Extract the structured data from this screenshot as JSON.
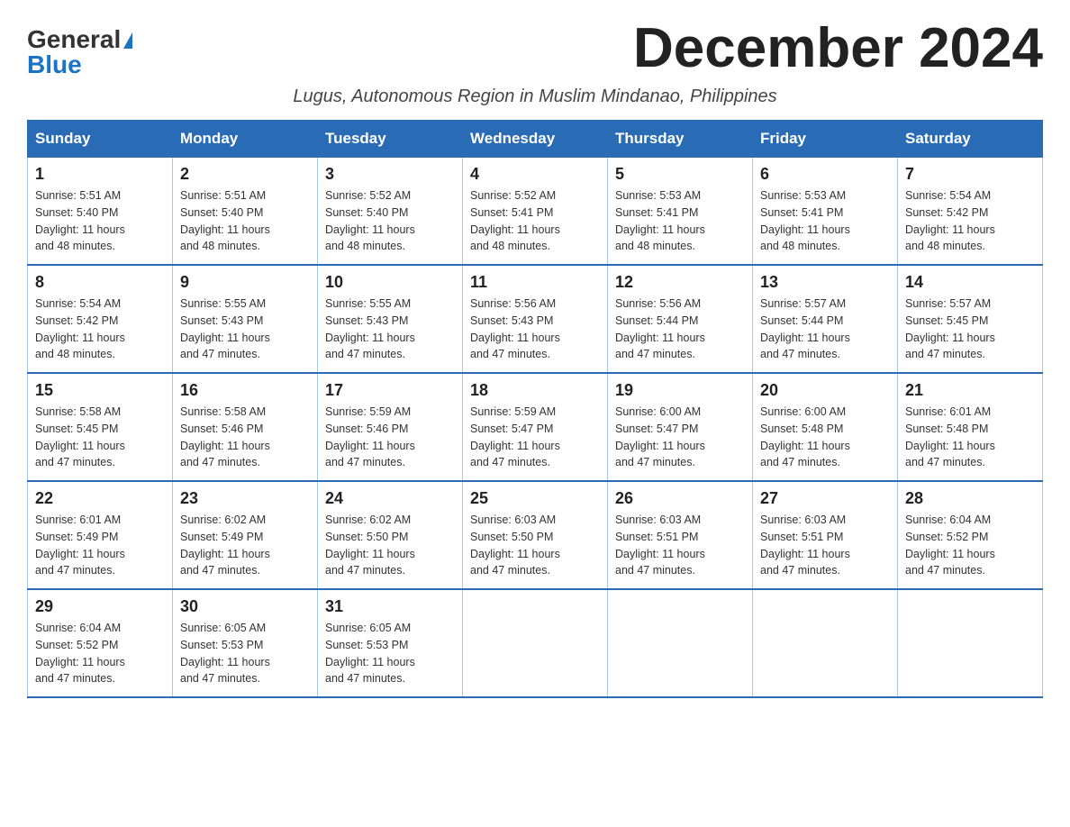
{
  "logo": {
    "general": "General",
    "blue": "Blue"
  },
  "title": "December 2024",
  "subtitle": "Lugus, Autonomous Region in Muslim Mindanao, Philippines",
  "headers": [
    "Sunday",
    "Monday",
    "Tuesday",
    "Wednesday",
    "Thursday",
    "Friday",
    "Saturday"
  ],
  "weeks": [
    [
      {
        "day": "1",
        "sunrise": "5:51 AM",
        "sunset": "5:40 PM",
        "daylight": "11 hours and 48 minutes."
      },
      {
        "day": "2",
        "sunrise": "5:51 AM",
        "sunset": "5:40 PM",
        "daylight": "11 hours and 48 minutes."
      },
      {
        "day": "3",
        "sunrise": "5:52 AM",
        "sunset": "5:40 PM",
        "daylight": "11 hours and 48 minutes."
      },
      {
        "day": "4",
        "sunrise": "5:52 AM",
        "sunset": "5:41 PM",
        "daylight": "11 hours and 48 minutes."
      },
      {
        "day": "5",
        "sunrise": "5:53 AM",
        "sunset": "5:41 PM",
        "daylight": "11 hours and 48 minutes."
      },
      {
        "day": "6",
        "sunrise": "5:53 AM",
        "sunset": "5:41 PM",
        "daylight": "11 hours and 48 minutes."
      },
      {
        "day": "7",
        "sunrise": "5:54 AM",
        "sunset": "5:42 PM",
        "daylight": "11 hours and 48 minutes."
      }
    ],
    [
      {
        "day": "8",
        "sunrise": "5:54 AM",
        "sunset": "5:42 PM",
        "daylight": "11 hours and 48 minutes."
      },
      {
        "day": "9",
        "sunrise": "5:55 AM",
        "sunset": "5:43 PM",
        "daylight": "11 hours and 47 minutes."
      },
      {
        "day": "10",
        "sunrise": "5:55 AM",
        "sunset": "5:43 PM",
        "daylight": "11 hours and 47 minutes."
      },
      {
        "day": "11",
        "sunrise": "5:56 AM",
        "sunset": "5:43 PM",
        "daylight": "11 hours and 47 minutes."
      },
      {
        "day": "12",
        "sunrise": "5:56 AM",
        "sunset": "5:44 PM",
        "daylight": "11 hours and 47 minutes."
      },
      {
        "day": "13",
        "sunrise": "5:57 AM",
        "sunset": "5:44 PM",
        "daylight": "11 hours and 47 minutes."
      },
      {
        "day": "14",
        "sunrise": "5:57 AM",
        "sunset": "5:45 PM",
        "daylight": "11 hours and 47 minutes."
      }
    ],
    [
      {
        "day": "15",
        "sunrise": "5:58 AM",
        "sunset": "5:45 PM",
        "daylight": "11 hours and 47 minutes."
      },
      {
        "day": "16",
        "sunrise": "5:58 AM",
        "sunset": "5:46 PM",
        "daylight": "11 hours and 47 minutes."
      },
      {
        "day": "17",
        "sunrise": "5:59 AM",
        "sunset": "5:46 PM",
        "daylight": "11 hours and 47 minutes."
      },
      {
        "day": "18",
        "sunrise": "5:59 AM",
        "sunset": "5:47 PM",
        "daylight": "11 hours and 47 minutes."
      },
      {
        "day": "19",
        "sunrise": "6:00 AM",
        "sunset": "5:47 PM",
        "daylight": "11 hours and 47 minutes."
      },
      {
        "day": "20",
        "sunrise": "6:00 AM",
        "sunset": "5:48 PM",
        "daylight": "11 hours and 47 minutes."
      },
      {
        "day": "21",
        "sunrise": "6:01 AM",
        "sunset": "5:48 PM",
        "daylight": "11 hours and 47 minutes."
      }
    ],
    [
      {
        "day": "22",
        "sunrise": "6:01 AM",
        "sunset": "5:49 PM",
        "daylight": "11 hours and 47 minutes."
      },
      {
        "day": "23",
        "sunrise": "6:02 AM",
        "sunset": "5:49 PM",
        "daylight": "11 hours and 47 minutes."
      },
      {
        "day": "24",
        "sunrise": "6:02 AM",
        "sunset": "5:50 PM",
        "daylight": "11 hours and 47 minutes."
      },
      {
        "day": "25",
        "sunrise": "6:03 AM",
        "sunset": "5:50 PM",
        "daylight": "11 hours and 47 minutes."
      },
      {
        "day": "26",
        "sunrise": "6:03 AM",
        "sunset": "5:51 PM",
        "daylight": "11 hours and 47 minutes."
      },
      {
        "day": "27",
        "sunrise": "6:03 AM",
        "sunset": "5:51 PM",
        "daylight": "11 hours and 47 minutes."
      },
      {
        "day": "28",
        "sunrise": "6:04 AM",
        "sunset": "5:52 PM",
        "daylight": "11 hours and 47 minutes."
      }
    ],
    [
      {
        "day": "29",
        "sunrise": "6:04 AM",
        "sunset": "5:52 PM",
        "daylight": "11 hours and 47 minutes."
      },
      {
        "day": "30",
        "sunrise": "6:05 AM",
        "sunset": "5:53 PM",
        "daylight": "11 hours and 47 minutes."
      },
      {
        "day": "31",
        "sunrise": "6:05 AM",
        "sunset": "5:53 PM",
        "daylight": "11 hours and 47 minutes."
      },
      null,
      null,
      null,
      null
    ]
  ],
  "labels": {
    "sunrise": "Sunrise:",
    "sunset": "Sunset:",
    "daylight": "Daylight:"
  }
}
